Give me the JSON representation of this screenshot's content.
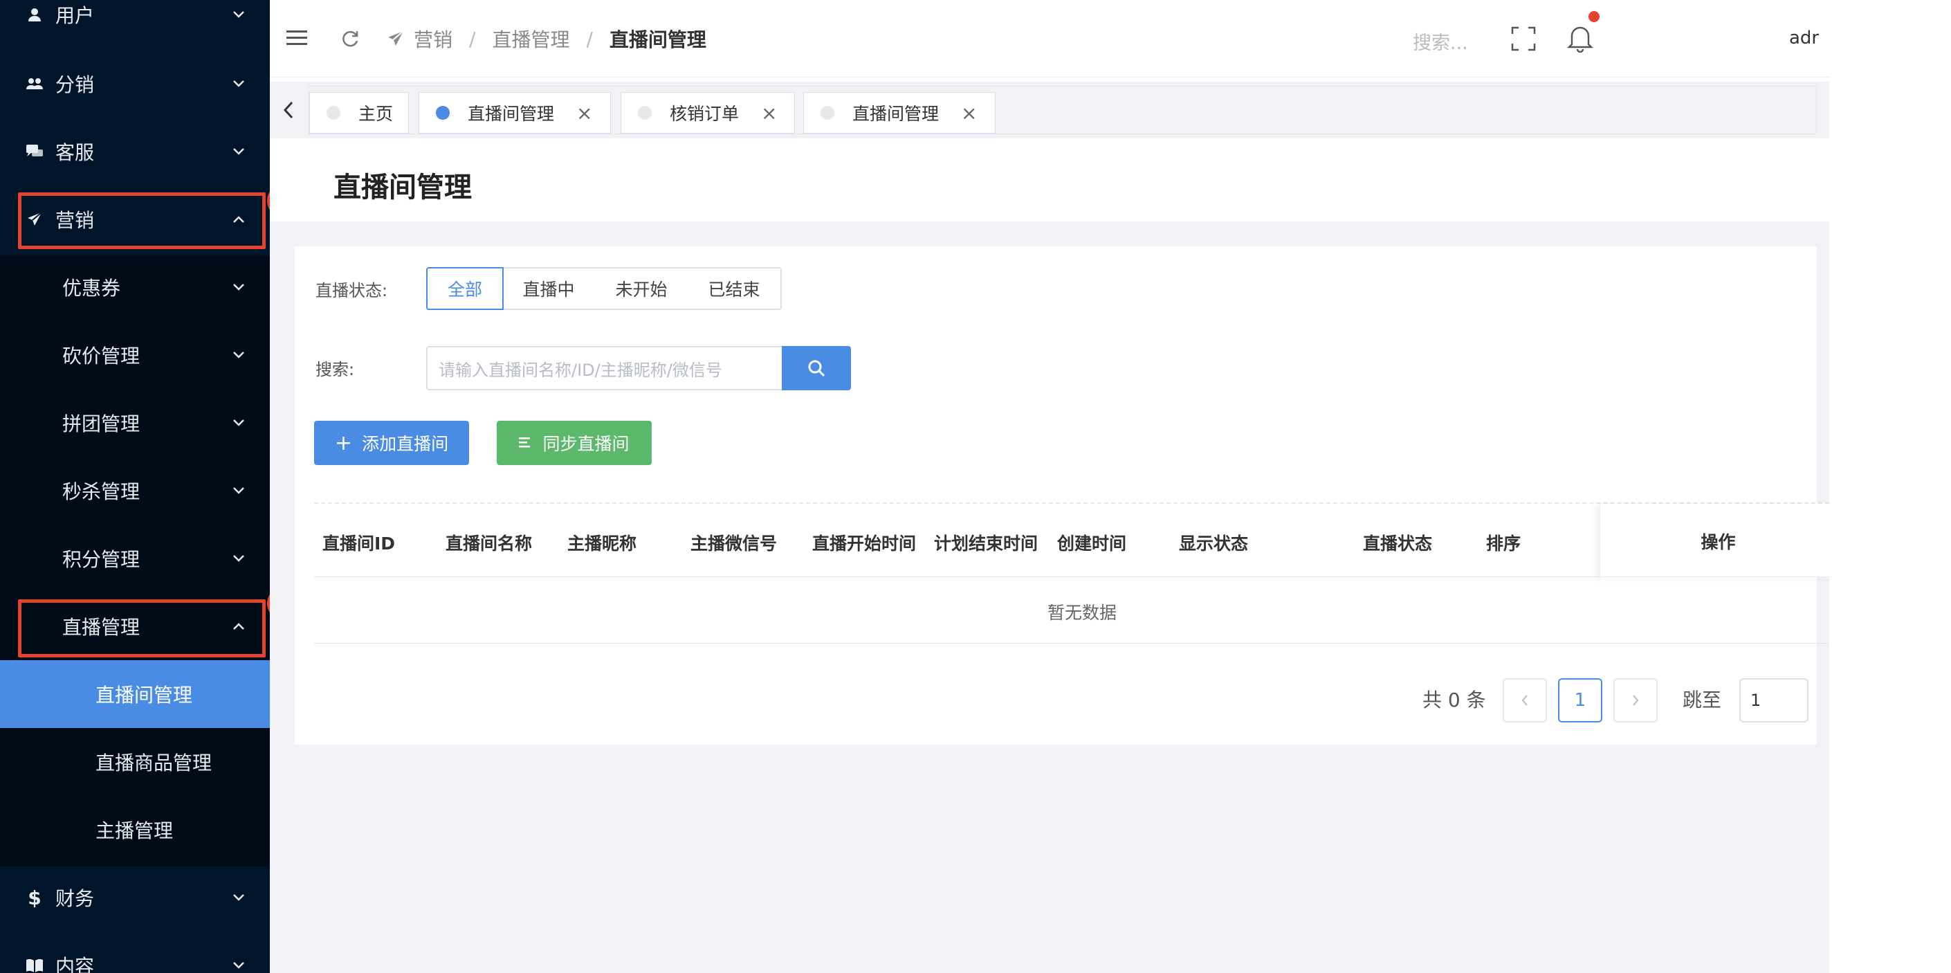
{
  "sidebar": {
    "items": [
      {
        "label": "用户",
        "icon": "user-icon",
        "expanded": false
      },
      {
        "label": "分销",
        "icon": "users-group-icon",
        "expanded": false
      },
      {
        "label": "客服",
        "icon": "chat-icon",
        "expanded": false
      },
      {
        "label": "营销",
        "icon": "send-icon",
        "expanded": true
      },
      {
        "label": "财务",
        "icon": "dollar-icon",
        "expanded": false
      },
      {
        "label": "内容",
        "icon": "book-icon",
        "expanded": false
      }
    ],
    "marketing_children": [
      {
        "label": "优惠券"
      },
      {
        "label": "砍价管理"
      },
      {
        "label": "拼团管理"
      },
      {
        "label": "秒杀管理"
      },
      {
        "label": "积分管理"
      },
      {
        "label": "直播管理"
      }
    ],
    "live_children": [
      {
        "label": "直播间管理",
        "active": true
      },
      {
        "label": "直播商品管理"
      },
      {
        "label": "主播管理"
      }
    ],
    "markers": [
      "1",
      "2"
    ]
  },
  "header": {
    "breadcrumb": [
      "营销",
      "直播管理",
      "直播间管理"
    ],
    "separator": "/",
    "search_placeholder": "搜索...",
    "username": "adr"
  },
  "tabs": [
    {
      "label": "主页",
      "closable": false,
      "active": false
    },
    {
      "label": "直播间管理",
      "closable": true,
      "active": true
    },
    {
      "label": "核销订单",
      "closable": true,
      "active": false
    },
    {
      "label": "直播间管理",
      "closable": true,
      "active": false
    }
  ],
  "page": {
    "title": "直播间管理",
    "status_label": "直播状态:",
    "status_options": [
      "全部",
      "直播中",
      "未开始",
      "已结束"
    ],
    "status_selected": "全部",
    "search_label": "搜索:",
    "search_placeholder": "请输入直播间名称/ID/主播昵称/微信号",
    "add_button": "添加直播间",
    "sync_button": "同步直播间",
    "table": {
      "columns": [
        "直播间ID",
        "直播间名称",
        "主播昵称",
        "主播微信号",
        "直播开始时间",
        "计划结束时间",
        "创建时间",
        "显示状态",
        "直播状态",
        "排序",
        "操作"
      ],
      "empty_text": "暂无数据"
    },
    "pagination": {
      "total_text": "共 0 条",
      "current_page": "1",
      "jump_label": "跳至",
      "jump_value": "1"
    }
  },
  "colors": {
    "sidebar_bg": "#001529",
    "submenu_bg": "#000c17",
    "accent": "#4a8ce4",
    "green": "#5cb86a",
    "marker_red": "#e5432f"
  }
}
